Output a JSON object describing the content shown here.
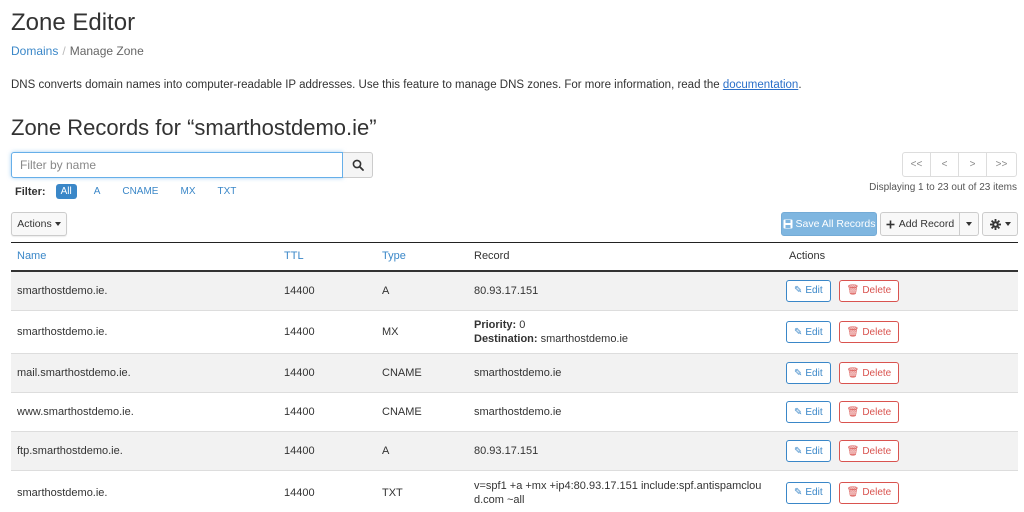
{
  "header": {
    "title": "Zone Editor",
    "breadcrumb": [
      {
        "label": "Domains"
      },
      {
        "label": "Manage Zone"
      }
    ],
    "separator": "/"
  },
  "intro": {
    "text": "DNS converts domain names into computer-readable IP addresses. Use this feature to manage DNS zones. For more information, read the ",
    "link": "documentation",
    "suffix": "."
  },
  "section_title": "Zone Records for “smarthostdemo.ie”",
  "search": {
    "placeholder": "Filter by name",
    "value": ""
  },
  "filter": {
    "label": "Filter:",
    "options": [
      "All",
      "A",
      "CNAME",
      "MX",
      "TXT"
    ],
    "active": "All"
  },
  "pager": {
    "buttons": [
      "<<",
      "<",
      ">",
      ">>"
    ],
    "status": "Displaying 1 to 23 out of 23 items"
  },
  "toolbar": {
    "actions_label": "Actions",
    "save_label": "Save All Records",
    "add_label": "Add Record"
  },
  "table": {
    "headers": [
      "Name",
      "TTL",
      "Type",
      "Record",
      "Actions"
    ],
    "edit_label": "Edit",
    "delete_label": "Delete",
    "rows": [
      {
        "name": "smarthostdemo.ie.",
        "ttl": "14400",
        "type": "A",
        "record": "80.93.17.151"
      },
      {
        "name": "smarthostdemo.ie.",
        "ttl": "14400",
        "type": "MX",
        "priority_label": "Priority:",
        "priority": "0",
        "destination_label": "Destination:",
        "destination": "smarthostdemo.ie"
      },
      {
        "name": "mail.smarthostdemo.ie.",
        "ttl": "14400",
        "type": "CNAME",
        "record": "smarthostdemo.ie"
      },
      {
        "name": "www.smarthostdemo.ie.",
        "ttl": "14400",
        "type": "CNAME",
        "record": "smarthostdemo.ie"
      },
      {
        "name": "ftp.smarthostdemo.ie.",
        "ttl": "14400",
        "type": "A",
        "record": "80.93.17.151"
      },
      {
        "name": "smarthostdemo.ie.",
        "ttl": "14400",
        "type": "TXT",
        "record_line1": "v=spf1 +a +mx +ip4:80.93.17.151 include:spf.antispamclou",
        "record_line2": "d.com ~all"
      }
    ]
  },
  "colors": {
    "link": "#3a87c8",
    "danger": "#d9534f",
    "save_button": "#7fb6e0"
  }
}
